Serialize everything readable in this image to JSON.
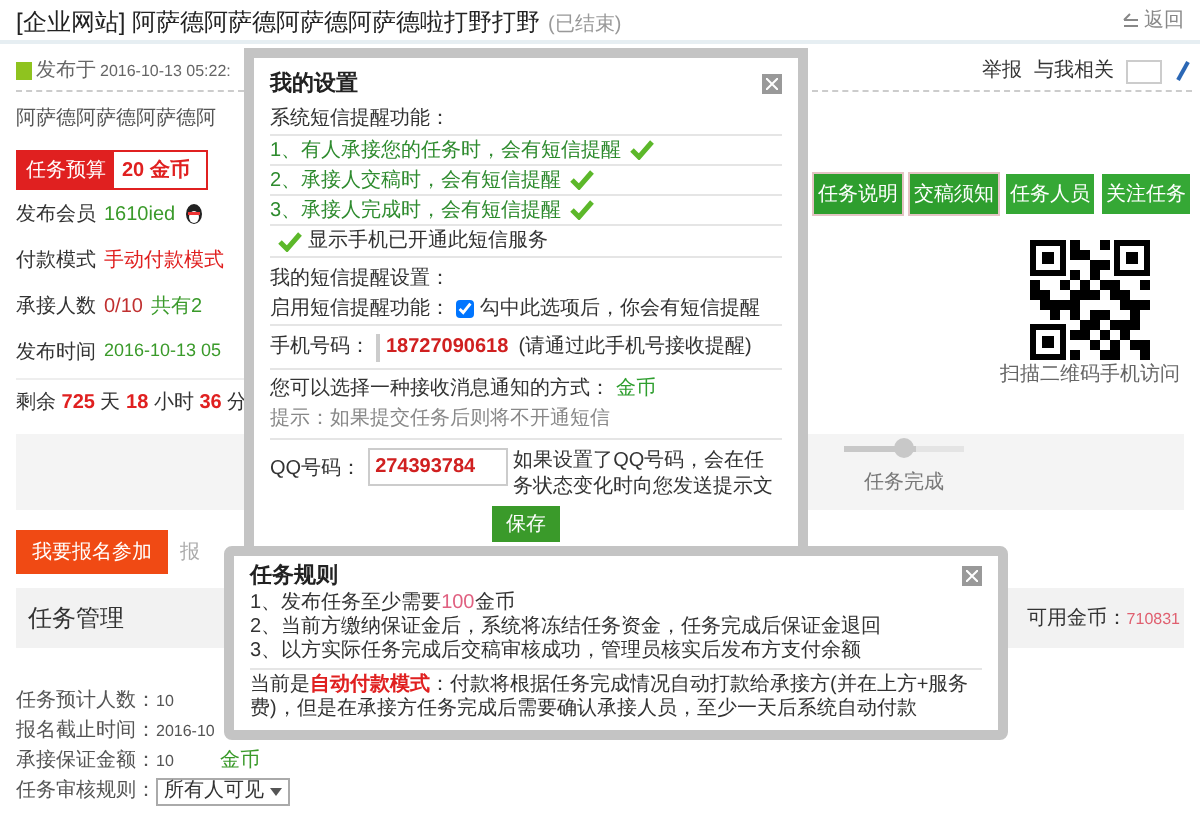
{
  "header": {
    "title": "[企业网站] 阿萨德阿萨德阿萨德阿萨德啦打野打野",
    "status": "(已结束)",
    "back": "返回"
  },
  "meta": {
    "posted_label": "发布于",
    "posted_time": "2016-10-13 05:22:",
    "report": "举报",
    "related": "与我相关"
  },
  "description": "阿萨德阿萨德阿萨德阿",
  "budget": {
    "label": "任务预算",
    "value": "20 金币"
  },
  "info": [
    {
      "label": "发布会员",
      "value": "1610ied",
      "kind": "member"
    },
    {
      "label": "付款模式",
      "value": "手动付款模式",
      "kind": "red"
    },
    {
      "label": "承接人数",
      "value": "0/10",
      "extra": "共有2",
      "kind": "count"
    },
    {
      "label": "发布时间",
      "value": "2016-10-13 05",
      "kind": "green"
    }
  ],
  "remaining": "剩余 **725** 天 **18** 小时 **36** 分",
  "actions": [
    {
      "label": "任务说明",
      "selected": true
    },
    {
      "label": "交稿须知",
      "selected": true
    },
    {
      "label": "任务人员",
      "selected": false
    },
    {
      "label": "关注任务",
      "selected": false
    }
  ],
  "qr_caption": "扫描二维码手机访问",
  "progress": {
    "step": "任务完成",
    "level": 0.6
  },
  "join_button": "我要报名参加",
  "join_note": "报",
  "manage": {
    "title": "任务管理",
    "coins_label": "可用金币：",
    "coins": "710831",
    "rows": [
      {
        "label": "任务预计人数：",
        "value": "10",
        "kind": "text"
      },
      {
        "label": "报名截止时间：",
        "value": "2016-10",
        "kind": "text"
      },
      {
        "label": "承接保证金额：",
        "value": "10",
        "unit": "金币",
        "kind": "text"
      },
      {
        "label": "任务审核规则：",
        "value": "所有人可见",
        "kind": "select"
      }
    ]
  },
  "settings_dialog": {
    "title": "我的设置",
    "system_title": "系统短信提醒功能：",
    "system_items": [
      {
        "text": "1、有人承接您的任务时，会有短信提醒",
        "checked": true
      },
      {
        "text": "2、承接人交稿时，会有短信提醒",
        "checked": true
      },
      {
        "text": "3、承接人完成时，会有短信提醒",
        "checked": true
      }
    ],
    "activated": {
      "text": "显示手机已开通此短信服务",
      "checked": true
    },
    "my_title": "我的短信提醒设置：",
    "enable": {
      "label": "启用短信提醒功能：",
      "checked": true,
      "note": "勾中此选项后，你会有短信提醒"
    },
    "phone": {
      "label": "手机号码：",
      "value": "18727090618",
      "note": "(请通过此手机号接收提醒)"
    },
    "method": {
      "text": "您可以选择一种接收消息通知的方式：",
      "value": "金币",
      "hint": "提示：如果提交任务后则将不开通短信"
    },
    "qq": {
      "label": "QQ号码：",
      "value": "274393784",
      "note": "如果设置了QQ号码，会在任务状态变化时向您发送提示文"
    },
    "save": "保存"
  },
  "rules_dialog": {
    "title": "任务规则",
    "items": [
      "1、发布任务至少需要**100**金币",
      "2、当前方缴纳保证金后，系统将冻结任务资金，任务完成后保证金退回",
      "3、以方实际任务完成后交稿审核成功，管理员核实后发布方支付余额"
    ],
    "note": "当前是**自动付款模式**：付款将根据任务完成情况自动打款给承接方(并在上方+服务费)，但是在承接方任务完成后需要确认承接人员，至少一天后系统自动付款"
  }
}
